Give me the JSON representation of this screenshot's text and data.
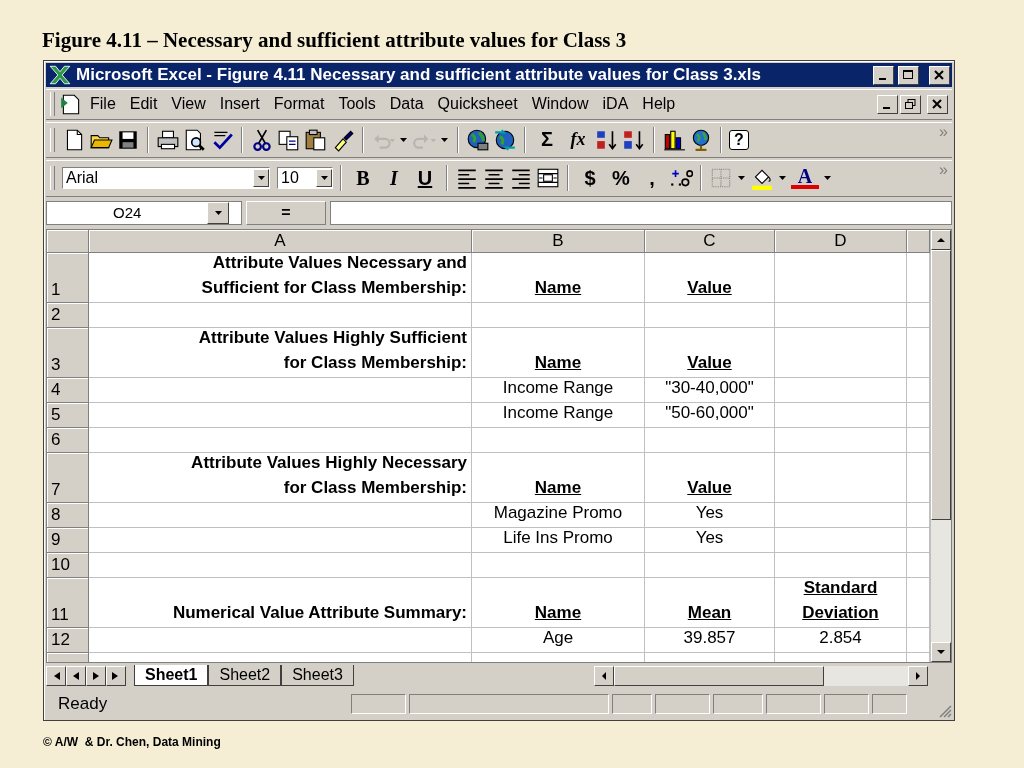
{
  "slide_title": "Figure 4.11 – Necessary and sufficient attribute values for Class 3",
  "window": {
    "title": "Microsoft Excel - Figure 4.11 Necessary and sufficient attribute values for Class 3.xls"
  },
  "menu": [
    {
      "label": "File"
    },
    {
      "label": "Edit"
    },
    {
      "label": "View"
    },
    {
      "label": "Insert"
    },
    {
      "label": "Format"
    },
    {
      "label": "Tools"
    },
    {
      "label": "Data"
    },
    {
      "label": "Quicksheet"
    },
    {
      "label": "Window"
    },
    {
      "label": "iDA"
    },
    {
      "label": "Help"
    }
  ],
  "standard_toolbar": {
    "overflow": "»",
    "items": [
      {
        "kind": "new",
        "disabled": false
      },
      {
        "kind": "open",
        "disabled": false
      },
      {
        "kind": "save",
        "disabled": false
      },
      {
        "kind": "sep"
      },
      {
        "kind": "print",
        "disabled": false
      },
      {
        "kind": "preview",
        "disabled": false
      },
      {
        "kind": "spelling",
        "disabled": false
      },
      {
        "kind": "sep"
      },
      {
        "kind": "cut",
        "disabled": false
      },
      {
        "kind": "copy",
        "disabled": false
      },
      {
        "kind": "paste",
        "disabled": false
      },
      {
        "kind": "painter",
        "disabled": false
      },
      {
        "kind": "sep"
      },
      {
        "kind": "undo",
        "disabled": true
      },
      {
        "kind": "redo",
        "disabled": true
      },
      {
        "kind": "sep"
      },
      {
        "kind": "web",
        "disabled": false
      },
      {
        "kind": "hyperlink",
        "disabled": false
      },
      {
        "kind": "sep"
      },
      {
        "kind": "sum",
        "text": "Σ",
        "disabled": false
      },
      {
        "kind": "function",
        "text": "fx",
        "disabled": false
      },
      {
        "kind": "sort-asc",
        "disabled": false
      },
      {
        "kind": "sort-desc",
        "disabled": false
      },
      {
        "kind": "sep"
      },
      {
        "kind": "chart",
        "disabled": false
      },
      {
        "kind": "map",
        "disabled": false
      },
      {
        "kind": "sep"
      },
      {
        "kind": "help",
        "text": "?",
        "disabled": false
      }
    ]
  },
  "formatting_toolbar": {
    "font": "Arial",
    "size": "10",
    "overflow": "»",
    "items": [
      {
        "kind": "bold",
        "text": "B"
      },
      {
        "kind": "italic",
        "text": "I"
      },
      {
        "kind": "underline",
        "text": "U"
      },
      {
        "kind": "sep"
      },
      {
        "kind": "align-left"
      },
      {
        "kind": "align-center"
      },
      {
        "kind": "align-right"
      },
      {
        "kind": "merge"
      },
      {
        "kind": "sep"
      },
      {
        "kind": "currency",
        "text": "$"
      },
      {
        "kind": "percent",
        "text": "%"
      },
      {
        "kind": "comma",
        "text": ","
      },
      {
        "kind": "decimal"
      },
      {
        "kind": "sep"
      },
      {
        "kind": "borders"
      },
      {
        "kind": "fill-color"
      },
      {
        "kind": "font-color",
        "text": "A"
      }
    ]
  },
  "formula_bar": {
    "name_box": "O24",
    "equals": "="
  },
  "sheet": {
    "columns": [
      "A",
      "B",
      "C",
      "D"
    ],
    "rows": [
      {
        "number": "1",
        "tall": true,
        "cells": [
          {
            "kind": "label",
            "text": "Attribute Values Necessary and\nSufficient for Class Membership:"
          },
          {
            "kind": "heading",
            "text": "Name"
          },
          {
            "kind": "heading",
            "text": "Value"
          },
          {
            "kind": "empty"
          }
        ]
      },
      {
        "number": "2",
        "tall": false,
        "cells": [
          {
            "kind": "empty"
          },
          {
            "kind": "empty"
          },
          {
            "kind": "empty"
          },
          {
            "kind": "empty"
          }
        ]
      },
      {
        "number": "3",
        "tall": true,
        "cells": [
          {
            "kind": "label",
            "text": "Attribute Values Highly Sufficient\nfor Class Membership:"
          },
          {
            "kind": "heading",
            "text": "Name"
          },
          {
            "kind": "heading",
            "text": "Value"
          },
          {
            "kind": "empty"
          }
        ]
      },
      {
        "number": "4",
        "tall": false,
        "cells": [
          {
            "kind": "empty"
          },
          {
            "kind": "value",
            "text": "Income Range"
          },
          {
            "kind": "value",
            "text": "\"30-40,000\""
          },
          {
            "kind": "empty"
          }
        ]
      },
      {
        "number": "5",
        "tall": false,
        "cells": [
          {
            "kind": "empty"
          },
          {
            "kind": "value",
            "text": "Income Range"
          },
          {
            "kind": "value",
            "text": "\"50-60,000\""
          },
          {
            "kind": "empty"
          }
        ]
      },
      {
        "number": "6",
        "tall": false,
        "cells": [
          {
            "kind": "empty"
          },
          {
            "kind": "empty"
          },
          {
            "kind": "empty"
          },
          {
            "kind": "empty"
          }
        ]
      },
      {
        "number": "7",
        "tall": true,
        "cells": [
          {
            "kind": "label",
            "text": "Attribute Values Highly Necessary\nfor Class Membership:"
          },
          {
            "kind": "heading",
            "text": "Name"
          },
          {
            "kind": "heading",
            "text": "Value"
          },
          {
            "kind": "empty"
          }
        ]
      },
      {
        "number": "8",
        "tall": false,
        "cells": [
          {
            "kind": "empty"
          },
          {
            "kind": "value",
            "text": "Magazine Promo"
          },
          {
            "kind": "value",
            "text": "Yes"
          },
          {
            "kind": "empty"
          }
        ]
      },
      {
        "number": "9",
        "tall": false,
        "cells": [
          {
            "kind": "empty"
          },
          {
            "kind": "value",
            "text": "Life Ins Promo"
          },
          {
            "kind": "value",
            "text": "Yes"
          },
          {
            "kind": "empty"
          }
        ]
      },
      {
        "number": "10",
        "tall": false,
        "cells": [
          {
            "kind": "empty"
          },
          {
            "kind": "empty"
          },
          {
            "kind": "empty"
          },
          {
            "kind": "empty"
          }
        ]
      },
      {
        "number": "11",
        "tall": true,
        "cells": [
          {
            "kind": "label",
            "text": "Numerical Value Attribute Summary:"
          },
          {
            "kind": "heading",
            "text": "Name"
          },
          {
            "kind": "heading",
            "text": "Mean"
          },
          {
            "kind": "heading",
            "text": "Standard\nDeviation"
          }
        ]
      },
      {
        "number": "12",
        "tall": false,
        "cells": [
          {
            "kind": "empty"
          },
          {
            "kind": "value",
            "text": "Age"
          },
          {
            "kind": "value",
            "text": "39.857"
          },
          {
            "kind": "value",
            "text": "2.854"
          }
        ]
      }
    ]
  },
  "sheet_tabs": [
    {
      "label": "Sheet1",
      "selected": true
    },
    {
      "label": "Sheet2",
      "selected": false
    },
    {
      "label": "Sheet3",
      "selected": false
    }
  ],
  "status_bar": {
    "text": "Ready"
  },
  "footer": {
    "credit": "© A/W  & Dr. Chen, Data Mining"
  }
}
